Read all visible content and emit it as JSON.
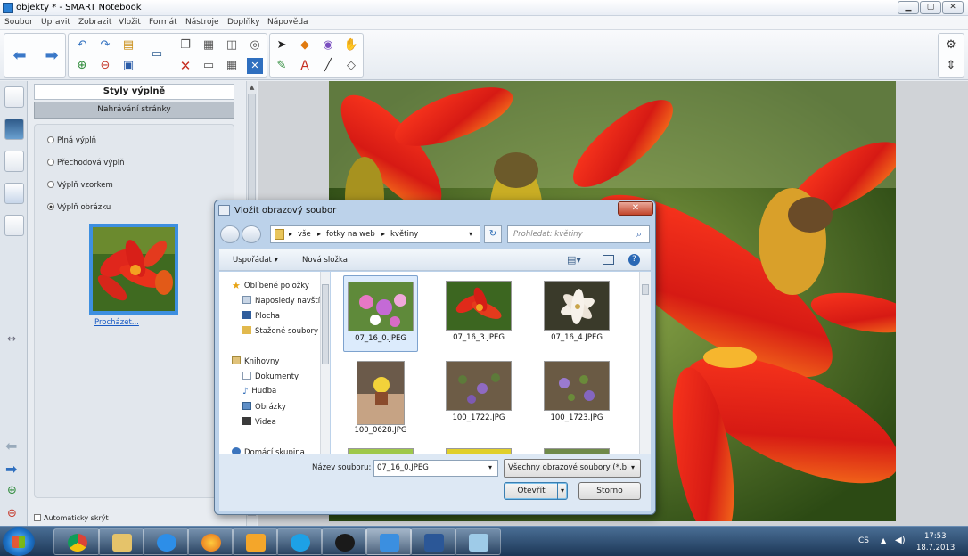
{
  "window": {
    "title": "objekty * - SMART Notebook",
    "buttons": [
      "▁",
      "▢",
      "✕"
    ]
  },
  "menu": [
    "Soubor",
    "Upravit",
    "Zobrazit",
    "Vložit",
    "Formát",
    "Nástroje",
    "Doplňky",
    "Nápověda"
  ],
  "panel": {
    "title": "Styly výplně",
    "subtitle": "Nahrávání stránky",
    "options": [
      {
        "label": "Plná výplň",
        "selected": false
      },
      {
        "label": "Přechodová výplň",
        "selected": false
      },
      {
        "label": "Výplň vzorkem",
        "selected": false
      },
      {
        "label": "Výplň obrázku",
        "selected": true
      }
    ],
    "browse": "Procházet...",
    "autohide": "Automaticky skrýt"
  },
  "dialog": {
    "title": "Vložit obrazový soubor",
    "close": "✕",
    "path": [
      "vše",
      "fotky na web",
      "květiny"
    ],
    "search_placeholder": "Prohledat: květiny",
    "organize": "Uspořádat ▾",
    "new_folder": "Nová složka",
    "nav": {
      "favorites": "Oblíbené položky",
      "fav_items": [
        "Naposledy navští",
        "Plocha",
        "Stažené soubory"
      ],
      "libraries": "Knihovny",
      "lib_items": [
        "Dokumenty",
        "Hudba",
        "Obrázky",
        "Videa"
      ],
      "homegroup": "Domácí skupina"
    },
    "files": [
      "07_16_0.JPEG",
      "07_16_3.JPEG",
      "07_16_4.JPEG",
      "100_0628.JPG",
      "100_1722.JPG",
      "100_1723.JPG"
    ],
    "filename_label": "Název souboru:",
    "filename_value": "07_16_0.JPEG",
    "filetype": "Všechny obrazové soubory (*.b",
    "open": "Otevřít",
    "cancel": "Storno"
  },
  "tray": {
    "lang": "CS",
    "time": "17:53",
    "date": "18.7.2013"
  }
}
